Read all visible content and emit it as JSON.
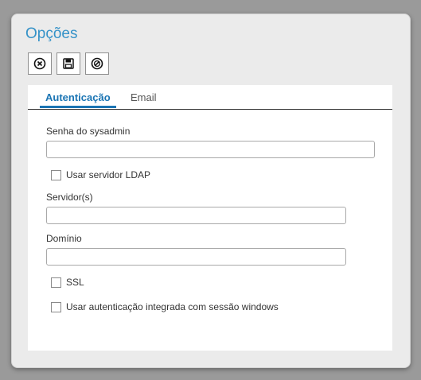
{
  "dialog": {
    "title": "Opções"
  },
  "toolbar": {
    "buttons": [
      {
        "name": "cancel",
        "icon": "circle-x-icon"
      },
      {
        "name": "save",
        "icon": "floppy-disk-icon"
      },
      {
        "name": "clear",
        "icon": "circle-slash-icon"
      }
    ]
  },
  "tabs": [
    {
      "label": "Autenticação",
      "active": true
    },
    {
      "label": "Email",
      "active": false
    }
  ],
  "form": {
    "sysadmin_password_label": "Senha do sysadmin",
    "sysadmin_password_value": "",
    "use_ldap_label": "Usar servidor LDAP",
    "use_ldap_checked": false,
    "servers_label": "Servidor(s)",
    "servers_value": "",
    "domain_label": "Domínio",
    "domain_value": "",
    "ssl_label": "SSL",
    "ssl_checked": false,
    "integrated_auth_label": "Usar autenticação integrada com sessão windows",
    "integrated_auth_checked": false
  },
  "colors": {
    "accent": "#1b75b4",
    "title": "#3592c8",
    "dialog_bg": "#ebebeb",
    "backdrop": "#9a9a9a"
  }
}
